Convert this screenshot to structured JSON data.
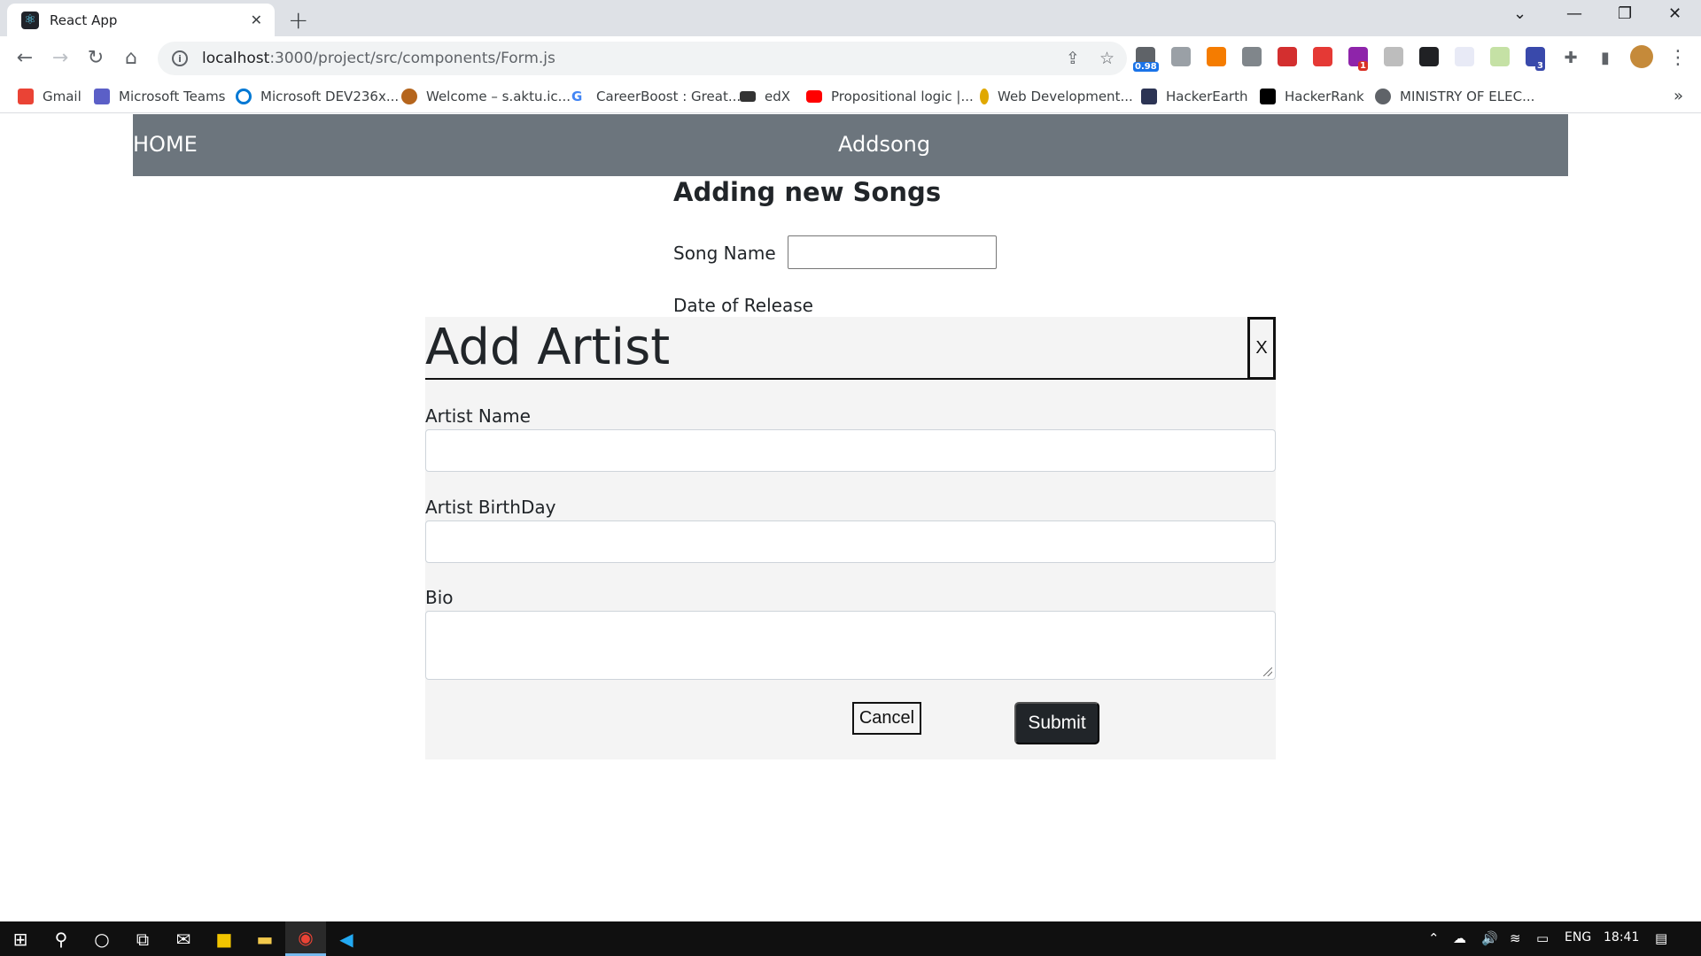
{
  "browser": {
    "tab_title": "React App",
    "url_host": "localhost",
    "url_path": ":3000/project/src/components/Form.js",
    "ext_badge_1": "0.98",
    "ext_badge_2": "1",
    "ext_badge_3": "3"
  },
  "bookmarks": [
    {
      "label": "Gmail",
      "icon": "gmail-icon",
      "color": "#ea4335"
    },
    {
      "label": "Microsoft Teams",
      "icon": "teams-icon",
      "color": "#5b5fc7"
    },
    {
      "label": "Microsoft DEV236x...",
      "icon": "ring-icon",
      "color": "#0078d4"
    },
    {
      "label": "Welcome – s.aktu.ic...",
      "icon": "seal-icon",
      "color": "#b5651d"
    },
    {
      "label": "CareerBoost : Great...",
      "icon": "google-icon",
      "color": "#4285f4"
    },
    {
      "label": "edX",
      "icon": "edx-icon",
      "color": "#333333"
    },
    {
      "label": "Propositional logic |...",
      "icon": "youtube-icon",
      "color": "#ff0000"
    },
    {
      "label": "Web Development...",
      "icon": "bulb-icon",
      "color": "#e0a800"
    },
    {
      "label": "HackerEarth",
      "icon": "hackerearth-icon",
      "color": "#2c3454"
    },
    {
      "label": "HackerRank",
      "icon": "hackerrank-icon",
      "color": "#000000"
    },
    {
      "label": "MINISTRY OF ELEC...",
      "icon": "globe-icon",
      "color": "#5f6368"
    }
  ],
  "navbar": {
    "home": "HOME",
    "addsong": "Addsong"
  },
  "form": {
    "title": "Adding new Songs",
    "song_name_label": "Song Name",
    "song_name_value": "",
    "date_label": "Date of Release"
  },
  "modal": {
    "title": "Add Artist",
    "close_label": "X",
    "artist_name_label": "Artist Name",
    "artist_name_value": "",
    "artist_birthday_label": "Artist BirthDay",
    "artist_birthday_value": "",
    "bio_label": "Bio",
    "bio_value": "",
    "cancel_label": "Cancel",
    "submit_label": "Submit"
  },
  "taskbar": {
    "language": "ENG",
    "time": "18:41"
  },
  "colors": {
    "navbar_bg": "#6c757d",
    "submit_bg": "#212529",
    "modal_bg": "#f4f4f4"
  }
}
